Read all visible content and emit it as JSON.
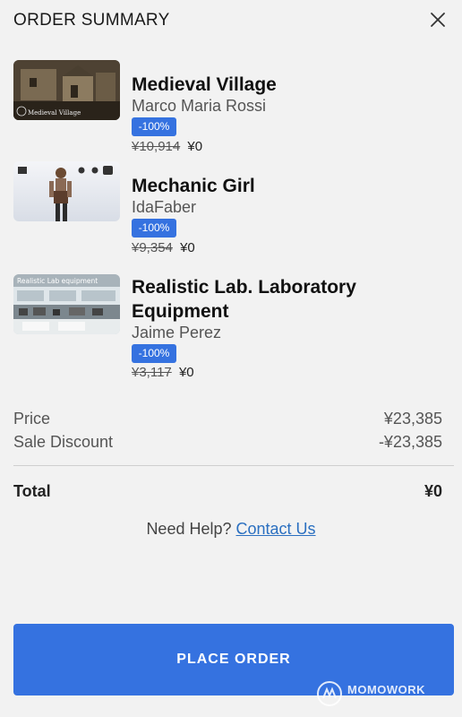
{
  "header": {
    "title": "ORDER SUMMARY",
    "close_icon": "close-icon"
  },
  "items": [
    {
      "title": "Medieval Village",
      "author": "Marco Maria Rossi",
      "discount": "-100%",
      "original_price": "¥10,914",
      "sale_price": "¥0",
      "thumbnail_caption": "Medieval Village"
    },
    {
      "title": "Mechanic Girl",
      "author": "IdaFaber",
      "discount": "-100%",
      "original_price": "¥9,354",
      "sale_price": "¥0"
    },
    {
      "title": "Realistic Lab. Laboratory Equipment",
      "author": "Jaime Perez",
      "discount": "-100%",
      "original_price": "¥3,117",
      "sale_price": "¥0",
      "thumbnail_caption": "Realistic Lab equipment"
    }
  ],
  "summary": {
    "price_label": "Price",
    "price_value": "¥23,385",
    "discount_label": "Sale Discount",
    "discount_value": "-¥23,385",
    "total_label": "Total",
    "total_value": "¥0"
  },
  "help": {
    "prefix": "Need Help?",
    "link": "Contact Us"
  },
  "actions": {
    "place_order": "PLACE ORDER"
  },
  "watermark": {
    "text": "MOMOWORK"
  },
  "colors": {
    "accent": "#3572e0",
    "link": "#2a6fc0",
    "background": "#f2f2f2"
  }
}
